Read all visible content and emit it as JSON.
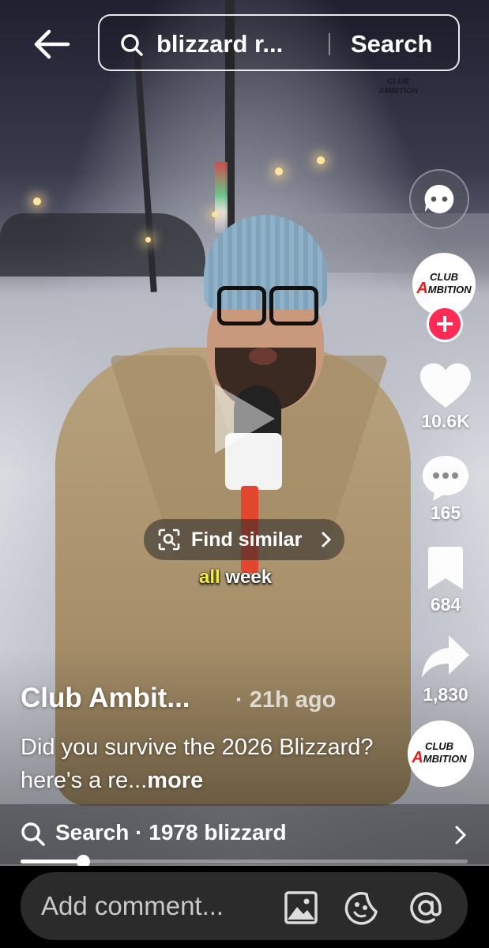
{
  "search": {
    "query": "blizzard r...",
    "submit_label": "Search"
  },
  "watermark": {
    "line1": "CLUB",
    "line2": "AMBITION"
  },
  "creator": {
    "name": "Club Ambit...",
    "posted": "· 21h ago",
    "avatar_text_top": "CLUB",
    "avatar_text_bottom": "MBITION",
    "avatar_accent": "#e0201f"
  },
  "stats": {
    "likes": "10.6K",
    "comments": "165",
    "saves": "684",
    "shares": "1,830"
  },
  "overlay": {
    "find_similar": "Find similar",
    "caption_highlight": "all",
    "caption_rest": " week"
  },
  "description": {
    "text": "Did you survive the 2026 Blizzard? here's a re...",
    "more": "more"
  },
  "related_search": {
    "label": "Search · 1978 blizzard"
  },
  "progress": {
    "fraction": 0.14
  },
  "comment_bar": {
    "placeholder": "Add comment..."
  },
  "colors": {
    "follow": "#fe2c55",
    "caption_highlight": "#f5f13a"
  },
  "icons": [
    "back-arrow-icon",
    "search-icon",
    "ai-chat-icon",
    "plus-icon",
    "heart-icon",
    "comment-bubble-icon",
    "bookmark-icon",
    "share-arrow-icon",
    "play-icon",
    "visual-search-icon",
    "chevron-right-icon",
    "image-icon",
    "emoji-icon",
    "at-sign-icon"
  ]
}
